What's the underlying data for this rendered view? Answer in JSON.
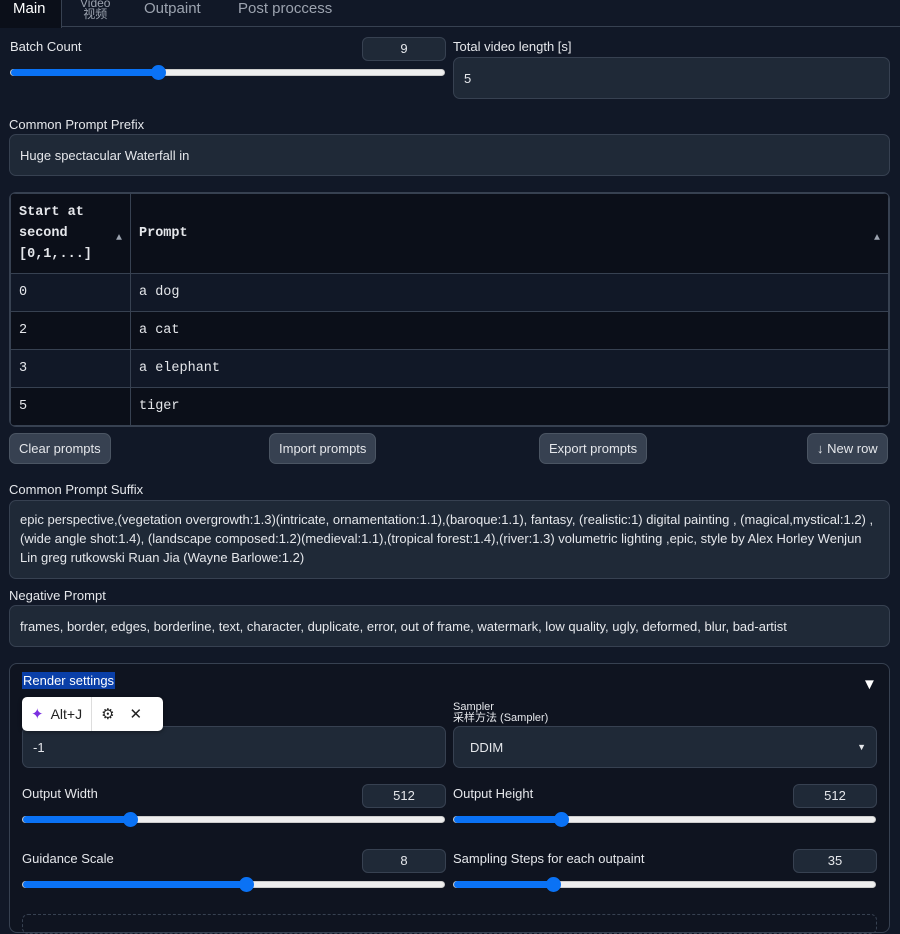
{
  "tabs": [
    {
      "label": "Main"
    },
    {
      "label": "Video",
      "sub": "视频"
    },
    {
      "label": "Outpaint"
    },
    {
      "label": "Post proccess"
    }
  ],
  "batch_count": {
    "label": "Batch Count",
    "value": "9",
    "fraction": 0.34
  },
  "video_length": {
    "label": "Total video length [s]",
    "value": "5"
  },
  "prefix": {
    "label": "Common Prompt Prefix",
    "value": "Huge spectacular Waterfall in"
  },
  "table": {
    "headers": [
      "Start at second [0,1,...]",
      "Prompt"
    ],
    "rows": [
      [
        "0",
        "a dog"
      ],
      [
        "2",
        "a cat"
      ],
      [
        "3",
        "a elephant"
      ],
      [
        "5",
        "tiger"
      ]
    ]
  },
  "buttons": {
    "clear": "Clear prompts",
    "import": "Import prompts",
    "export": "Export prompts",
    "new_row": "New row"
  },
  "suffix": {
    "label": "Common Prompt Suffix",
    "value": "epic perspective,(vegetation overgrowth:1.3)(intricate, ornamentation:1.1),(baroque:1.1), fantasy, (realistic:1) digital painting , (magical,mystical:1.2) , (wide angle shot:1.4), (landscape composed:1.2)(medieval:1.1),(tropical forest:1.4),(river:1.3) volumetric lighting ,epic, style by Alex Horley Wenjun Lin greg rutkowski Ruan Jia (Wayne Barlowe:1.2)"
  },
  "negative": {
    "label": "Negative Prompt",
    "value": "frames, border, edges, borderline, text, character, duplicate, error, out of frame, watermark, low quality, ugly, deformed, blur, bad-artist"
  },
  "render": {
    "title": "Render settings",
    "popup": {
      "shortcut": "Alt+J"
    },
    "seed": {
      "value": "-1"
    },
    "sampler": {
      "label": "Sampler",
      "sublabel": "采样方法 (Sampler)",
      "value": "DDIM"
    },
    "width": {
      "label": "Output Width",
      "value": "512",
      "fraction": 0.255
    },
    "height": {
      "label": "Output Height",
      "value": "512",
      "fraction": 0.253
    },
    "guidance": {
      "label": "Guidance Scale",
      "value": "8",
      "fraction": 0.53
    },
    "steps": {
      "label": "Sampling Steps for each outpaint",
      "value": "35",
      "fraction": 0.236
    }
  },
  "colors": {
    "accent": "#0a72f5",
    "selection": "#0a3fa8"
  }
}
